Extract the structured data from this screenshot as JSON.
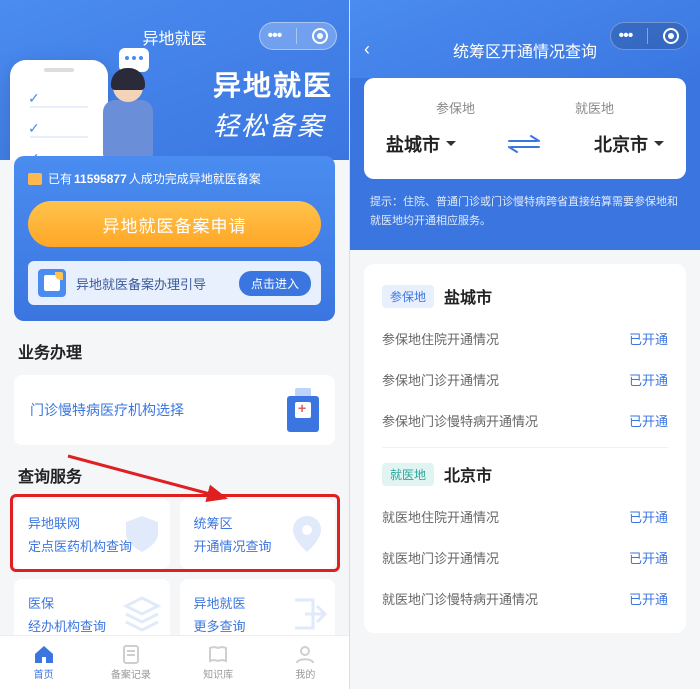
{
  "left": {
    "header_title": "异地就医",
    "hero_line1": "异地就医",
    "hero_line2": "轻松备案",
    "stat_prefix": "已有",
    "stat_number": "11595877",
    "stat_suffix": "人成功完成异地就医备案",
    "apply_button": "异地就医备案申请",
    "guide_text": "异地就医备案办理引导",
    "guide_button": "点击进入",
    "section_biz": "业务办理",
    "biz_item": "门诊慢特病医疗机构选择",
    "section_query": "查询服务",
    "query_items": [
      {
        "l1": "异地联网",
        "l2": "定点医药机构查询"
      },
      {
        "l1": "统筹区",
        "l2": "开通情况查询"
      },
      {
        "l1": "医保",
        "l2": "经办机构查询"
      },
      {
        "l1": "异地就医",
        "l2": "更多查询"
      }
    ],
    "tabs": [
      {
        "label": "首页",
        "active": true
      },
      {
        "label": "备案记录",
        "active": false
      },
      {
        "label": "知识库",
        "active": false
      },
      {
        "label": "我的",
        "active": false
      }
    ]
  },
  "right": {
    "header_title": "统筹区开通情况查询",
    "insured_label": "参保地",
    "treat_label": "就医地",
    "insured_city": "盐城市",
    "treat_city": "北京市",
    "tip": "提示：住院、普通门诊或门诊慢特病跨省直接结算需要参保地和就医地均开通相应服务。",
    "groups": [
      {
        "badge": "参保地",
        "badge_style": "blue",
        "city": "盐城市",
        "rows": [
          {
            "label": "参保地住院开通情况",
            "value": "已开通"
          },
          {
            "label": "参保地门诊开通情况",
            "value": "已开通"
          },
          {
            "label": "参保地门诊慢特病开通情况",
            "value": "已开通"
          }
        ]
      },
      {
        "badge": "就医地",
        "badge_style": "teal",
        "city": "北京市",
        "rows": [
          {
            "label": "就医地住院开通情况",
            "value": "已开通"
          },
          {
            "label": "就医地门诊开通情况",
            "value": "已开通"
          },
          {
            "label": "就医地门诊慢特病开通情况",
            "value": "已开通"
          }
        ]
      }
    ]
  }
}
